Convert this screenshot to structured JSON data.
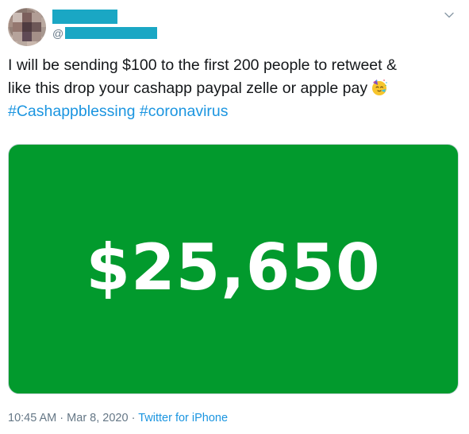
{
  "header": {
    "handle_prefix": "@",
    "caret_icon": "chevron-down-icon",
    "redaction_color": "#1aa7c4"
  },
  "tweet": {
    "line1": "I will be sending $100 to the first 200 people to retweet &",
    "line2": "like this drop your cashapp paypal zelle or apple pay",
    "emoji": "partying-face-icon",
    "hashtags": [
      "#Cashappblessing",
      "#coronavirus"
    ]
  },
  "media": {
    "amount": "$25,650",
    "background_color": "#029a2d"
  },
  "footer": {
    "time": "10:45 AM",
    "separator": "·",
    "date": "Mar 8, 2020",
    "source": "Twitter for iPhone"
  }
}
